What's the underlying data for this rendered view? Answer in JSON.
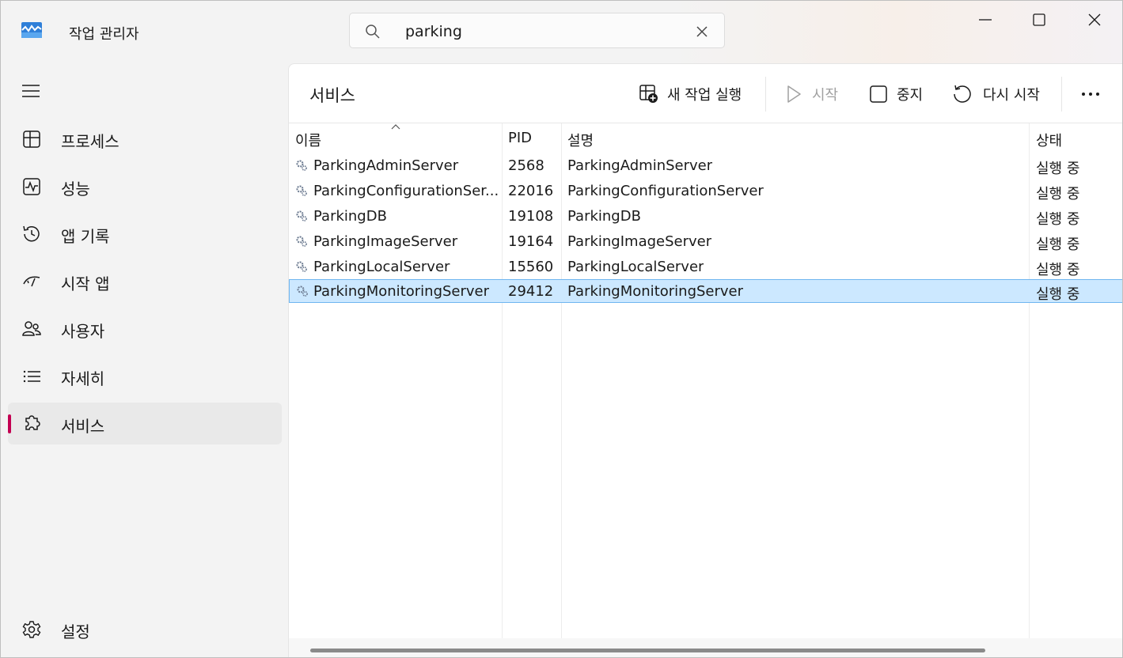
{
  "app": {
    "title": "작업 관리자"
  },
  "search": {
    "value": "parking"
  },
  "nav": {
    "items": [
      {
        "id": "processes",
        "label": "프로세스",
        "icon": "processes-icon"
      },
      {
        "id": "performance",
        "label": "성능",
        "icon": "performance-icon"
      },
      {
        "id": "app-history",
        "label": "앱 기록",
        "icon": "history-icon"
      },
      {
        "id": "startup",
        "label": "시작 앱",
        "icon": "startup-icon"
      },
      {
        "id": "users",
        "label": "사용자",
        "icon": "users-icon"
      },
      {
        "id": "details",
        "label": "자세히",
        "icon": "list-icon"
      },
      {
        "id": "services",
        "label": "서비스",
        "icon": "puzzle-icon",
        "active": true
      }
    ],
    "settings": {
      "label": "설정"
    }
  },
  "main": {
    "title": "서비스",
    "toolbar": {
      "new_task": "새 작업 실행",
      "start": "시작",
      "stop": "중지",
      "restart": "다시 시작"
    },
    "columns": {
      "name": "이름",
      "pid": "PID",
      "desc": "설명",
      "status": "상태"
    },
    "rows": [
      {
        "name": "ParkingAdminServer",
        "pid": "2568",
        "desc": "ParkingAdminServer",
        "status": "실행 중"
      },
      {
        "name": "ParkingConfigurationSer...",
        "pid": "22016",
        "desc": "ParkingConfigurationServer",
        "status": "실행 중"
      },
      {
        "name": "ParkingDB",
        "pid": "19108",
        "desc": "ParkingDB",
        "status": "실행 중"
      },
      {
        "name": "ParkingImageServer",
        "pid": "19164",
        "desc": "ParkingImageServer",
        "status": "실행 중"
      },
      {
        "name": "ParkingLocalServer",
        "pid": "15560",
        "desc": "ParkingLocalServer",
        "status": "실행 중"
      },
      {
        "name": "ParkingMonitoringServer",
        "pid": "29412",
        "desc": "ParkingMonitoringServer",
        "status": "실행 중",
        "selected": true
      }
    ]
  },
  "colors": {
    "accent": "#c30052",
    "selection": "#cce8ff"
  }
}
